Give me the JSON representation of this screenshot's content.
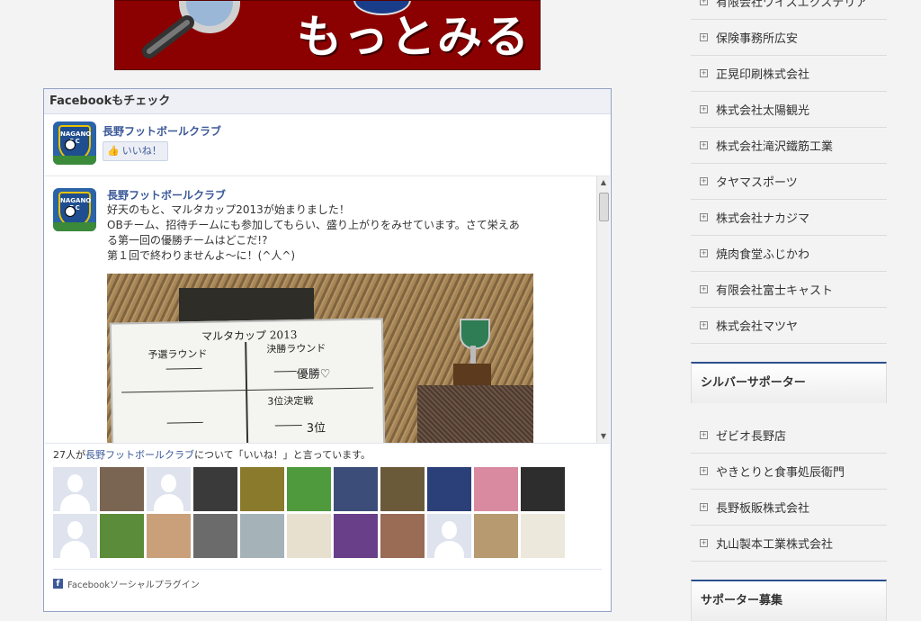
{
  "banner": {
    "text": "もっとみる"
  },
  "facebook": {
    "header": "Facebookもチェック",
    "page_name": "長野フットボールクラブ",
    "like_label": "いいね！",
    "logo_text": "NAGANO F.C",
    "post": {
      "author": "長野フットボールクラブ",
      "lines": [
        "好天のもと、マルタカップ2013が始まりました！",
        "OBチーム、招待チームにも参加してもらい、盛り上がりをみせています。さて栄えあ",
        "る第一回の優勝チームはどこだ!?",
        "第１回で終わりませんよ～に！(^人^)"
      ],
      "photo": {
        "board_title": "マルタカップ 2013",
        "left_label": "予選ラウンド",
        "right_label": "決勝ラウンド",
        "winner": "優勝♡",
        "third": "3位",
        "third_label": "3位決定戦"
      }
    },
    "fans_count_prefix": "27人が",
    "fans_count_link": "長野フットボールクラブ",
    "fans_count_suffix": "について「いいね！」と言っています。",
    "footer": "Facebookソーシャルプラグイン",
    "fans": [
      {
        "type": "silhouette"
      },
      {
        "type": "photo",
        "color": "#7a6553"
      },
      {
        "type": "silhouette"
      },
      {
        "type": "photo",
        "color": "#3a3a3a"
      },
      {
        "type": "photo",
        "color": "#8a7a2c"
      },
      {
        "type": "photo",
        "color": "#4f9a3d"
      },
      {
        "type": "photo",
        "color": "#3c4d7a"
      },
      {
        "type": "photo",
        "color": "#6b5a3a"
      },
      {
        "type": "photo",
        "color": "#2b3f78"
      },
      {
        "type": "photo",
        "color": "#d98aa0"
      },
      {
        "type": "photo",
        "color": "#2d2d2d"
      },
      {
        "type": "silhouette"
      },
      {
        "type": "photo",
        "color": "#5b8c3a"
      },
      {
        "type": "photo",
        "color": "#c9a07a"
      },
      {
        "type": "photo",
        "color": "#6b6b6b"
      },
      {
        "type": "photo",
        "color": "#a5b3b8"
      },
      {
        "type": "photo",
        "color": "#e8e0cf"
      },
      {
        "type": "photo",
        "color": "#6a3f8a"
      },
      {
        "type": "photo",
        "color": "#9a6b55"
      },
      {
        "type": "silhouette"
      },
      {
        "type": "photo",
        "color": "#b89a70"
      },
      {
        "type": "photo",
        "color": "#ece8dc"
      }
    ]
  },
  "sidebar": {
    "sponsors_top": [
      "有限会社ワイスエクステリア",
      "保険事務所広安",
      "正晃印刷株式会社",
      "株式会社太陽観光",
      "株式会社滝沢鐵筋工業",
      "タヤマスポーツ",
      "株式会社ナカジマ",
      "焼肉食堂ふじかわ",
      "有限会社富士キャスト",
      "株式会社マツヤ"
    ],
    "silver_heading": "シルバーサポーター",
    "silver_sponsors": [
      "ゼビオ長野店",
      "やきとりと食事処辰衛門",
      "長野板販株式会社",
      "丸山製本工業株式会社"
    ],
    "recruit_heading": "サポーター募集"
  }
}
